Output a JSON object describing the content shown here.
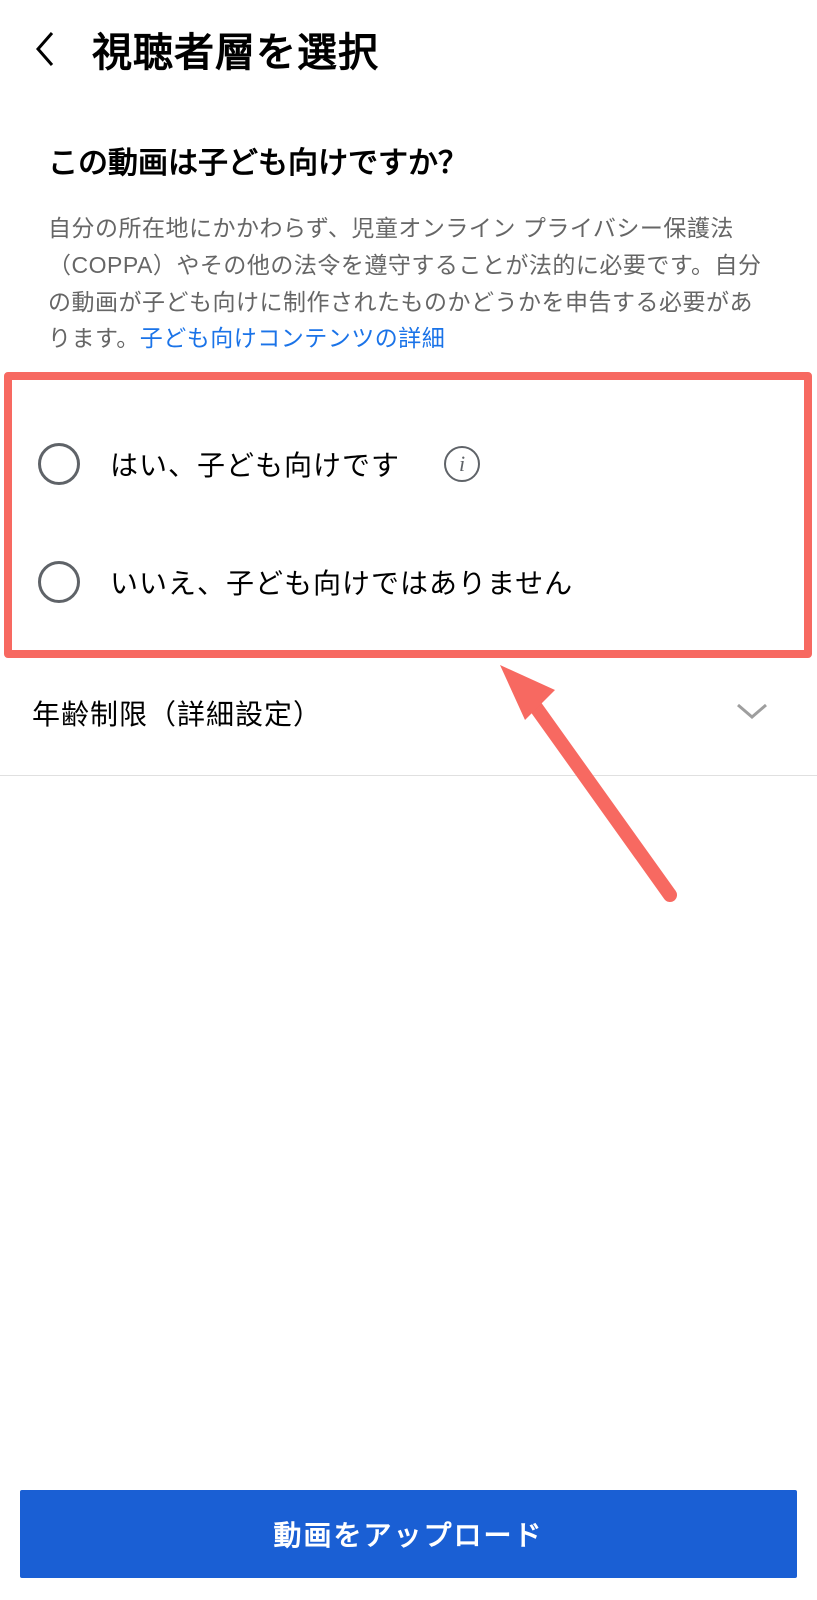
{
  "header": {
    "title": "視聴者層を選択"
  },
  "question": "この動画は子ども向けですか？",
  "description_part1": "自分の所在地にかかわらず、児童オンライン プライバシー保護法（COPPA）やその他の法令を遵守することが法的に必要です。自分の動画が子ども向けに制作されたものかどうかを申告する必要があります。",
  "description_link": "子ども向けコンテンツの詳細",
  "radio_options": {
    "yes": "はい、子ども向けです",
    "no": "いいえ、子ども向けではありません"
  },
  "age_restriction": {
    "label": "年齢制限（詳細設定）"
  },
  "upload_button": "動画をアップロード",
  "colors": {
    "highlight_border": "#f76961",
    "link": "#1a73e8",
    "button": "#1a5fd4"
  }
}
